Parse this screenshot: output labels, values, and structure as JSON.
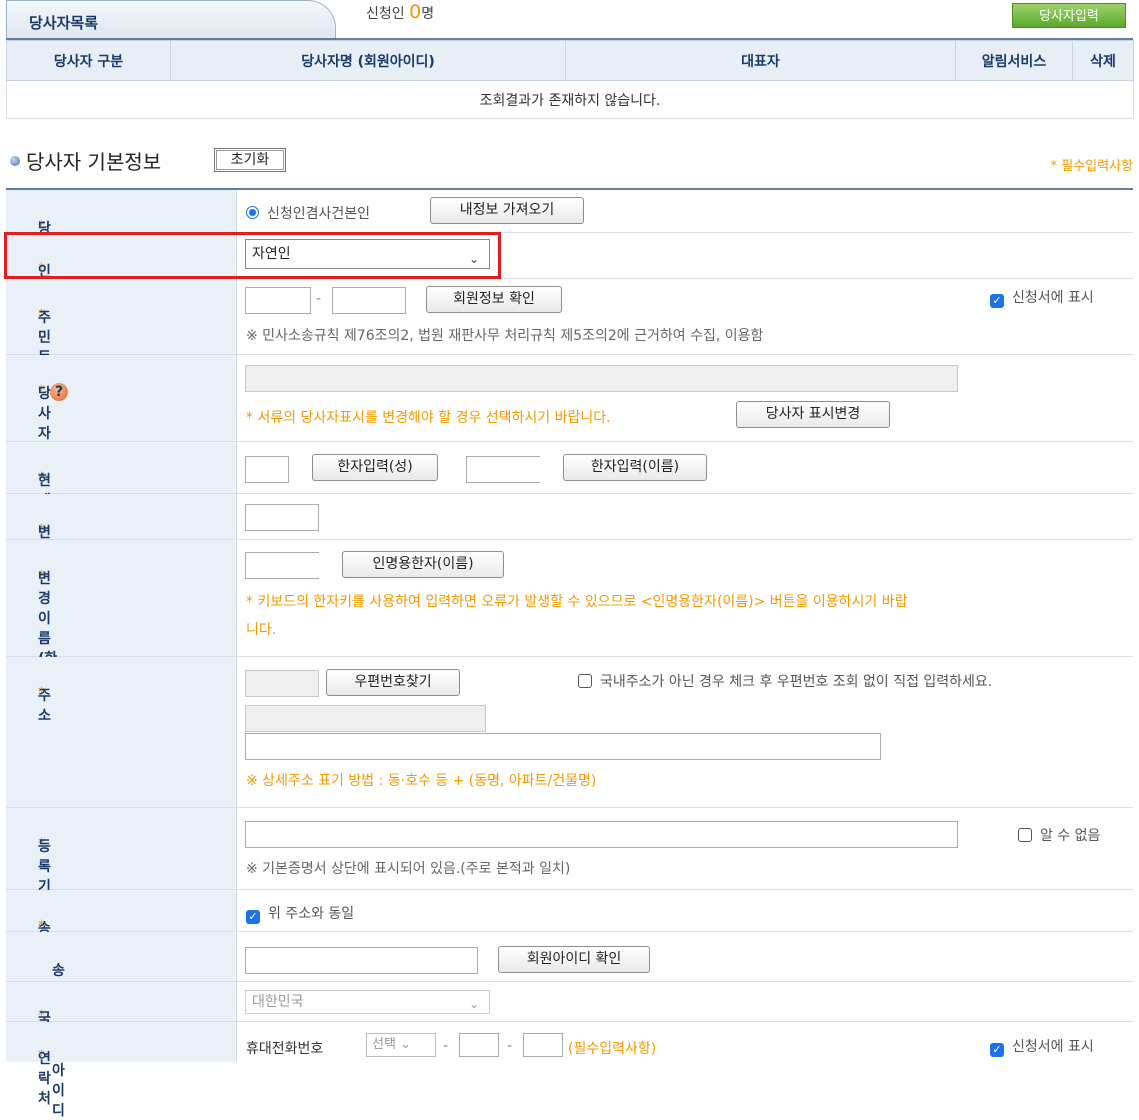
{
  "tab": {
    "title": "당사자목록"
  },
  "applicant_count": {
    "prefix": "신청인",
    "number": "0",
    "suffix": "명"
  },
  "add_party_button": "당사자입력",
  "list": {
    "headers": [
      "당사자 구분",
      "당사자명 (회원아이디)",
      "대표자",
      "알림서비스",
      "삭제"
    ],
    "empty_message": "조회결과가 존재하지 않습니다."
  },
  "section": {
    "title": "당사자 기본정보",
    "reset_button": "초기화",
    "required_note": "* 필수입력사항"
  },
  "rows": {
    "party_type": {
      "label": "당사자 구분",
      "radio_label": "신청인겸사건본인",
      "button": "내정보 가져오기"
    },
    "person_type": {
      "label": "인격 구분",
      "value": "자연인"
    },
    "rrn": {
      "label": "주민등록번호",
      "dash": "-",
      "button": "회원정보 확인",
      "checkbox_label": "신청서에 표시",
      "note": "※ 민사소송규칙 제76조의2, 법원 재판사무 처리규칙 제5조의2에 근거하여 수집, 이용함"
    },
    "party_name": {
      "label": "당사자명",
      "note": "* 서류의 당사자표시를 변경해야 할 경우 선택하시기 바랍니다.",
      "button": "당사자 표시변경"
    },
    "name_hanja": {
      "label": "현재이름(한자)",
      "button_surname": "한자입력(성)",
      "button_given": "한자입력(이름)"
    },
    "changed_name": {
      "label": "변경이름"
    },
    "changed_name_hanja": {
      "label": "변경이름(한자)",
      "button": "인명용한자(이름)",
      "note_line1": "* 키보드의 한자키를 사용하여 입력하면 오류가 발생할 수 있으므로 <인명용한자(이름)> 버튼을 이용하시기 바랍",
      "note_line2": "니다."
    },
    "address": {
      "label": "주소",
      "button": "우편번호찾기",
      "checkbox_label": "국내주소가 아닌 경우 체크 후 우편번호 조회 없이 직접 입력하세요.",
      "note": "※ 상세주소 표기 방법 : 동·호수 등 + (동명, 아파트/건물명)"
    },
    "registry_base": {
      "label": "등록기준지",
      "checkbox_label": "알 수 없음",
      "note": "※ 기본증명서 상단에 표시되어 있음.(주로 본적과 일치)"
    },
    "delivery_place": {
      "label": "송달장소",
      "checkbox_label": "위 주소와 동일"
    },
    "delivery_receiver_id": {
      "label": "송달영수인 아이디",
      "button": "회원아이디 확인"
    },
    "nationality": {
      "label": "국적",
      "value": "대한민국"
    },
    "contact": {
      "label": "연락처",
      "phone_label": "휴대전화번호",
      "select_value": "선택",
      "dash": "-",
      "required": "(필수입력사항)",
      "checkbox_label": "신청서에 표시"
    }
  }
}
